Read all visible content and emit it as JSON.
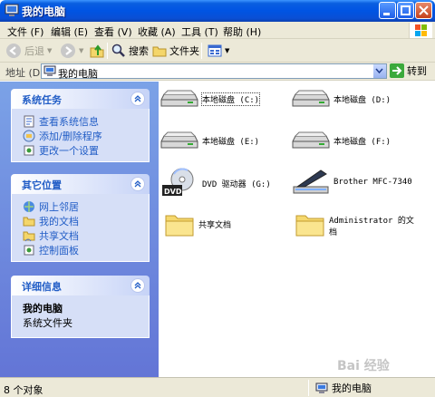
{
  "window": {
    "title": "我的电脑"
  },
  "menu": [
    "文件 (F)",
    "编辑 (E)",
    "查看 (V)",
    "收藏 (A)",
    "工具 (T)",
    "帮助 (H)"
  ],
  "toolbar": {
    "back": "后退",
    "search": "搜索",
    "folders": "文件夹"
  },
  "address": {
    "label": "地址 (D)",
    "value": "我的电脑",
    "go": "转到"
  },
  "panels": {
    "system": {
      "title": "系统任务",
      "items": [
        "查看系统信息",
        "添加/删除程序",
        "更改一个设置"
      ]
    },
    "other": {
      "title": "其它位置",
      "items": [
        "网上邻居",
        "我的文档",
        "共享文档",
        "控制面板"
      ]
    },
    "details": {
      "title": "详细信息",
      "name": "我的电脑",
      "type": "系统文件夹"
    }
  },
  "items": [
    {
      "label": "本地磁盘 (C:)",
      "icon": "drive-icon"
    },
    {
      "label": "本地磁盘 (D:)",
      "icon": "drive-icon"
    },
    {
      "label": "本地磁盘 (E:)",
      "icon": "drive-icon"
    },
    {
      "label": "本地磁盘 (F:)",
      "icon": "drive-icon"
    },
    {
      "label": "DVD 驱动器 (G:)",
      "icon": "dvd-icon"
    },
    {
      "label": "Brother MFC-7340",
      "icon": "scanner-icon"
    },
    {
      "label": "共享文档",
      "icon": "folder-icon"
    },
    {
      "label_line1": "Administrator 的文",
      "label_line2": "档",
      "icon": "folder-icon"
    }
  ],
  "status": {
    "left": "8 个对象",
    "right": "我的电脑"
  },
  "watermark": "Bai 经验",
  "colors": {
    "title_blue": "#0054e3",
    "task_link": "#215dc6",
    "sidebar": "#7ba2e7"
  }
}
